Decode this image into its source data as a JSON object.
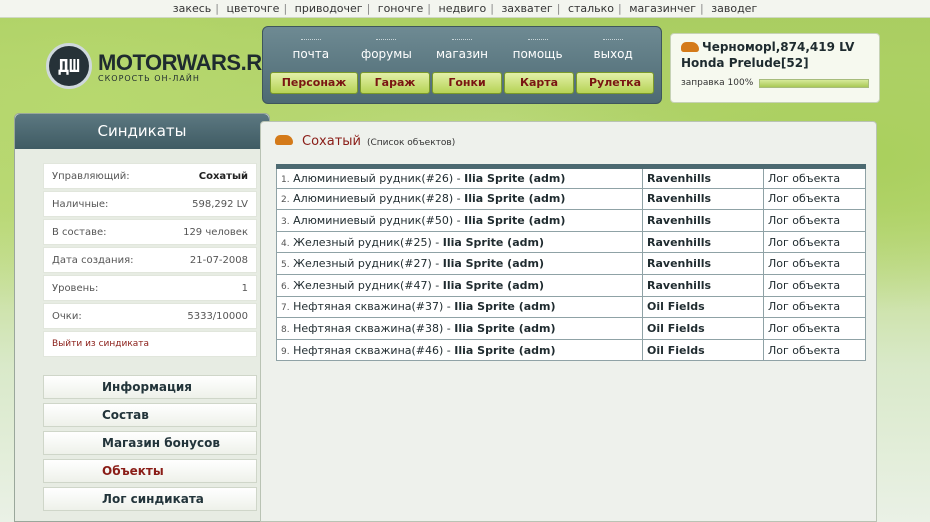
{
  "topnav": [
    "закесь",
    "цветочге",
    "приводочег",
    "гоночге",
    "недвиго",
    "захватег",
    "сталько",
    "магазинчег",
    "заводег"
  ],
  "logo": {
    "mark": "ДШ",
    "title": "MOTORWARS.RU",
    "subtitle": "СКОРОСТЬ ОН-ЛАЙН"
  },
  "menu": {
    "top": [
      "почта",
      "форумы",
      "магазин",
      "помощь",
      "выход"
    ],
    "buttons": [
      "Персонаж",
      "Гараж",
      "Гонки",
      "Карта",
      "Рулетка"
    ]
  },
  "player": {
    "name_money": "Черноморl,874,419 LV",
    "car": "Honda Prelude[52]",
    "fuel_label": "заправка 100%",
    "fuel_fraction": 1.0
  },
  "sidebar": {
    "title": "Синдикаты",
    "info": [
      {
        "label": "Управляющий:",
        "value": "Сохатый",
        "bold": true
      },
      {
        "label": "Наличные:",
        "value": "598,292 LV"
      },
      {
        "label": "В составе:",
        "value": "129 человек"
      },
      {
        "label": "Дата создания:",
        "value": "21-07-2008"
      },
      {
        "label": "Уровень:",
        "value": "1"
      },
      {
        "label": "Очки:",
        "value": "5333/10000"
      }
    ],
    "leave": "Выйти из синдиката",
    "menu": [
      "Информация",
      "Состав",
      "Магазин бонусов",
      "Объекты",
      "Лог синдиката"
    ],
    "active": "Объекты"
  },
  "main": {
    "title": "Сохатый",
    "subtitle": "(Список объектов)",
    "rows": [
      {
        "n": "1.",
        "name": "Алюминиевый рудник(#26)",
        "owner": "Ilia Sprite (adm)",
        "region": "Ravenhills",
        "log": "Лог объекта"
      },
      {
        "n": "2.",
        "name": "Алюминиевый рудник(#28)",
        "owner": "Ilia Sprite (adm)",
        "region": "Ravenhills",
        "log": "Лог объекта"
      },
      {
        "n": "3.",
        "name": "Алюминиевый рудник(#50)",
        "owner": "Ilia Sprite (adm)",
        "region": "Ravenhills",
        "log": "Лог объекта"
      },
      {
        "n": "4.",
        "name": "Железный рудник(#25)",
        "owner": "Ilia Sprite (adm)",
        "region": "Ravenhills",
        "log": "Лог объекта"
      },
      {
        "n": "5.",
        "name": "Железный рудник(#27)",
        "owner": "Ilia Sprite (adm)",
        "region": "Ravenhills",
        "log": "Лог объекта"
      },
      {
        "n": "6.",
        "name": "Железный рудник(#47)",
        "owner": "Ilia Sprite (adm)",
        "region": "Ravenhills",
        "log": "Лог объекта"
      },
      {
        "n": "7.",
        "name": "Нефтяная скважина(#37)",
        "owner": "Ilia Sprite (adm)",
        "region": "Oil Fields",
        "log": "Лог объекта"
      },
      {
        "n": "8.",
        "name": "Нефтяная скважина(#38)",
        "owner": "Ilia Sprite (adm)",
        "region": "Oil Fields",
        "log": "Лог объекта"
      },
      {
        "n": "9.",
        "name": "Нефтяная скважина(#46)",
        "owner": "Ilia Sprite (adm)",
        "region": "Oil Fields",
        "log": "Лог объекта"
      }
    ]
  },
  "colors": {
    "accent_red": "#8a1d17",
    "panel": "#4d6a73",
    "button_green": "#b6d356"
  }
}
